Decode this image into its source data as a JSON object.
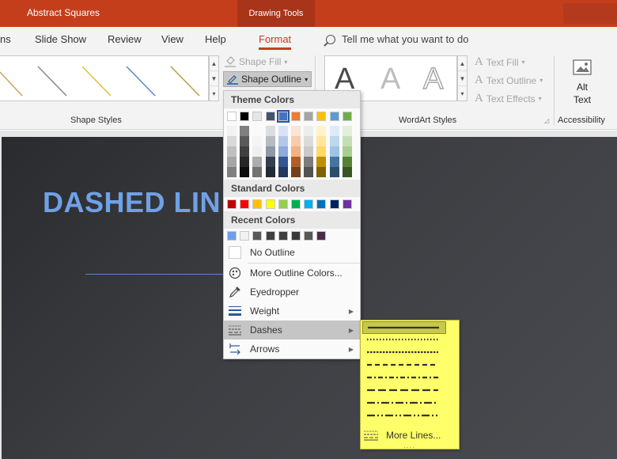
{
  "window": {
    "title": "Abstract Squares",
    "context_tab": "Drawing Tools"
  },
  "tabs": [
    {
      "label": "ns",
      "active": false
    },
    {
      "label": "Slide Show",
      "active": false
    },
    {
      "label": "Review",
      "active": false
    },
    {
      "label": "View",
      "active": false
    },
    {
      "label": "Help",
      "active": false
    },
    {
      "label": "Format",
      "active": true
    }
  ],
  "tell_me": {
    "text": "Tell me what you want to do",
    "icon": "search-icon"
  },
  "ribbon": {
    "shape_styles_label": "Shape Styles",
    "shape_fill": "Shape Fill",
    "shape_outline": "Shape Outline",
    "wordart_label": "WordArt Styles",
    "text_fill": "Text Fill",
    "text_outline": "Text Outline",
    "text_effects": "Text Effects",
    "alt_text_line1": "Alt",
    "alt_text_line2": "Text",
    "accessibility_label": "Accessibility",
    "wordart_sample": "A"
  },
  "slide": {
    "title": "DASHED LIN"
  },
  "outline_menu": {
    "theme_colors_label": "Theme Colors",
    "standard_colors_label": "Standard Colors",
    "recent_colors_label": "Recent Colors",
    "theme_colors": [
      "#ffffff",
      "#000000",
      "#e7e6e6",
      "#44546a",
      "#4472c4",
      "#ed7d31",
      "#a5a5a5",
      "#ffc000",
      "#5b9bd5",
      "#70ad47"
    ],
    "standard_colors": [
      "#c00000",
      "#ff0000",
      "#ffc000",
      "#ffff00",
      "#92d050",
      "#00b050",
      "#00b0f0",
      "#0070c0",
      "#002060",
      "#7030a0"
    ],
    "recent_colors": [
      "#6d9eeb",
      "#f2f2f2",
      "#595959",
      "#404040",
      "#404040",
      "#3a3a3a",
      "#595959",
      "#4a2c4a"
    ],
    "items": {
      "no_outline": "No Outline",
      "more_colors": "More Outline Colors...",
      "eyedropper": "Eyedropper",
      "weight": "Weight",
      "dashes": "Dashes",
      "arrows": "Arrows"
    }
  },
  "dashes_menu": {
    "options": [
      "Solid",
      "Round Dot",
      "Square Dot",
      "Dash",
      "Dash Dot",
      "Long Dash",
      "Long Dash Dot",
      "Long Dash Dot Dot"
    ],
    "selected": "Solid",
    "more_lines": "More Lines..."
  }
}
